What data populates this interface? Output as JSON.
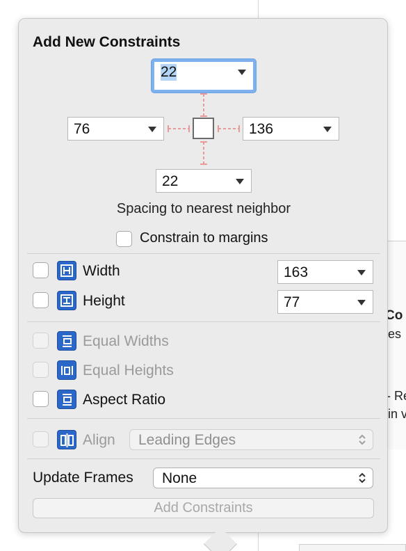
{
  "popover": {
    "title": "Add New Constraints",
    "spacing": {
      "top": "22",
      "left": "76",
      "right": "136",
      "bottom": "22"
    },
    "spacing_caption": "Spacing to nearest neighbor",
    "constrain_to_margins": {
      "label": "Constrain to margins",
      "checked": false
    },
    "width": {
      "label": "Width",
      "value": "163",
      "checked": false
    },
    "height": {
      "label": "Height",
      "value": "77",
      "checked": false
    },
    "equal_widths": {
      "label": "Equal Widths",
      "enabled": false
    },
    "equal_heights": {
      "label": "Equal Heights",
      "enabled": false
    },
    "aspect_ratio": {
      "label": "Aspect Ratio",
      "checked": false
    },
    "align": {
      "label": "Align",
      "value": "Leading Edges",
      "enabled": false
    },
    "update_frames": {
      "label": "Update Frames",
      "value": "None"
    },
    "add_button_label": "Add Constraints"
  },
  "background": {
    "fragment_con": "Co",
    "fragment_es": "es",
    "fragment_re": "- Re",
    "fragment_in": "in v"
  },
  "colors": {
    "accent_focus": "#7fb1ee",
    "icon_blue": "#2b67c9",
    "strut_red": "#e89a9a"
  }
}
